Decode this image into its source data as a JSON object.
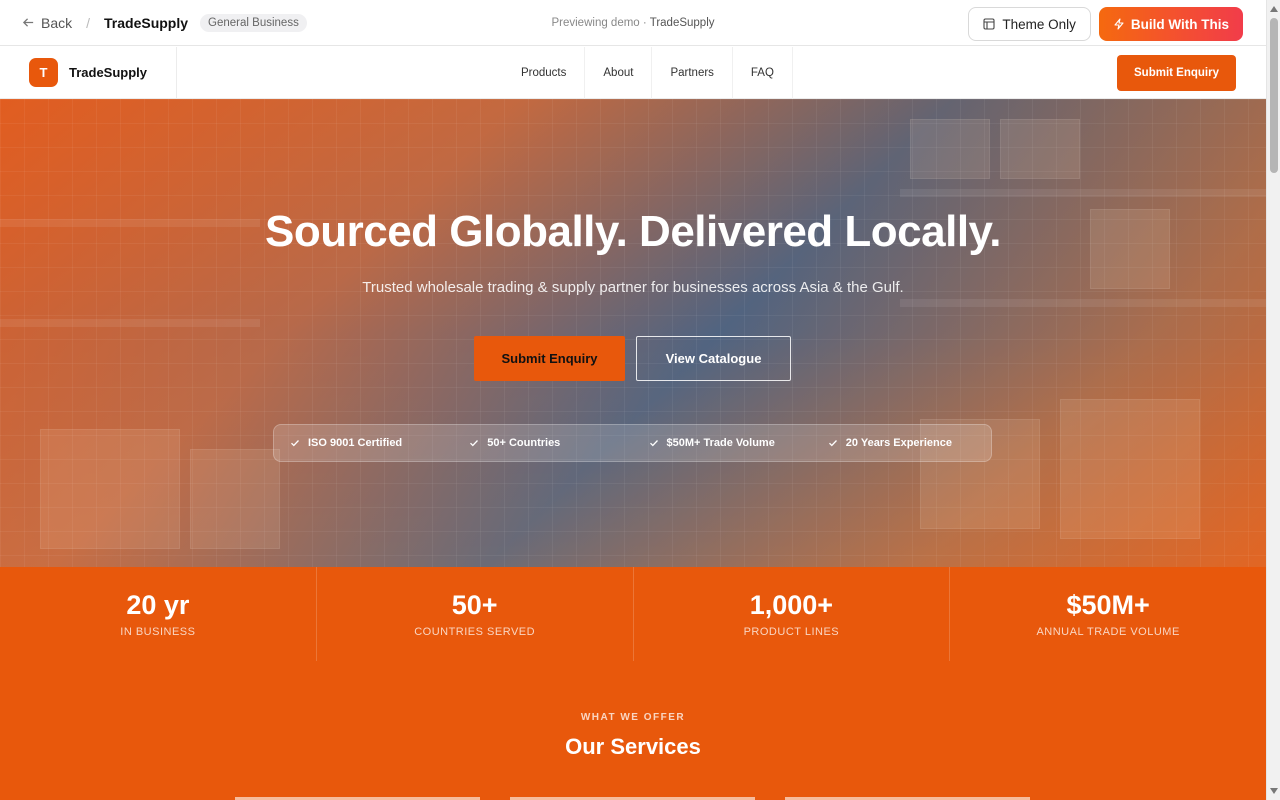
{
  "preview_bar": {
    "back_label": "Back",
    "site_name": "TradeSupply",
    "category_badge": "General Business",
    "preview_prefix": "Previewing demo ·",
    "preview_name": "TradeSupply",
    "theme_only_label": "Theme Only",
    "build_label": "Build With This"
  },
  "nav": {
    "logo_letter": "T",
    "brand": "TradeSupply",
    "links": [
      "Products",
      "About",
      "Partners",
      "FAQ"
    ],
    "cta": "Submit Enquiry"
  },
  "hero": {
    "title": "Sourced Globally. Delivered Locally.",
    "subtitle": "Trusted wholesale trading & supply partner for businesses across Asia & the Gulf.",
    "primary_cta": "Submit Enquiry",
    "secondary_cta": "View Catalogue",
    "badges": [
      "ISO 9001 Certified",
      "50+ Countries",
      "$50M+ Trade Volume",
      "20 Years Experience"
    ]
  },
  "stats": [
    {
      "value": "20 yr",
      "label": "IN BUSINESS"
    },
    {
      "value": "50+",
      "label": "COUNTRIES SERVED"
    },
    {
      "value": "1,000+",
      "label": "PRODUCT LINES"
    },
    {
      "value": "$50M+",
      "label": "ANNUAL TRADE VOLUME"
    }
  ],
  "services": {
    "eyebrow": "WHAT WE OFFER",
    "title": "Our Services"
  },
  "colors": {
    "accent": "#e8580c",
    "build_gradient_start": "#f5690f",
    "build_gradient_end": "#f23c4a"
  }
}
